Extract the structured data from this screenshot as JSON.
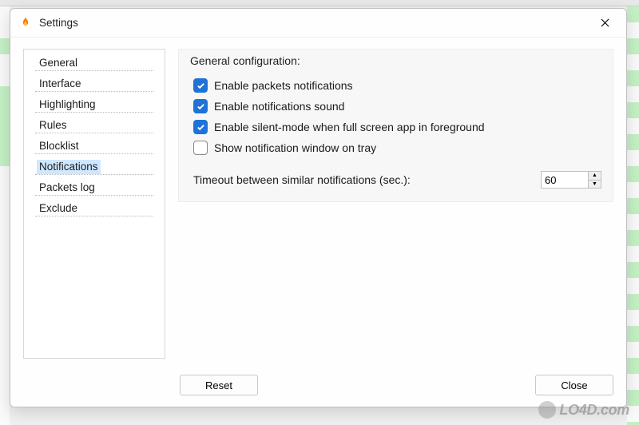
{
  "window": {
    "title": "Settings"
  },
  "sidebar": {
    "items": [
      {
        "label": "General",
        "selected": false
      },
      {
        "label": "Interface",
        "selected": false
      },
      {
        "label": "Highlighting",
        "selected": false
      },
      {
        "label": "Rules",
        "selected": false
      },
      {
        "label": "Blocklist",
        "selected": false
      },
      {
        "label": "Notifications",
        "selected": true
      },
      {
        "label": "Packets log",
        "selected": false
      },
      {
        "label": "Exclude",
        "selected": false
      }
    ]
  },
  "section": {
    "title": "General configuration:",
    "checks": [
      {
        "label": "Enable packets notifications",
        "checked": true
      },
      {
        "label": "Enable notifications sound",
        "checked": true
      },
      {
        "label": "Enable silent-mode when full screen app in foreground",
        "checked": true
      },
      {
        "label": "Show notification window on tray",
        "checked": false
      }
    ],
    "timeout_label": "Timeout between similar notifications (sec.):",
    "timeout_value": "60"
  },
  "footer": {
    "reset_label": "Reset",
    "close_label": "Close"
  },
  "watermark": "LO4D.com"
}
